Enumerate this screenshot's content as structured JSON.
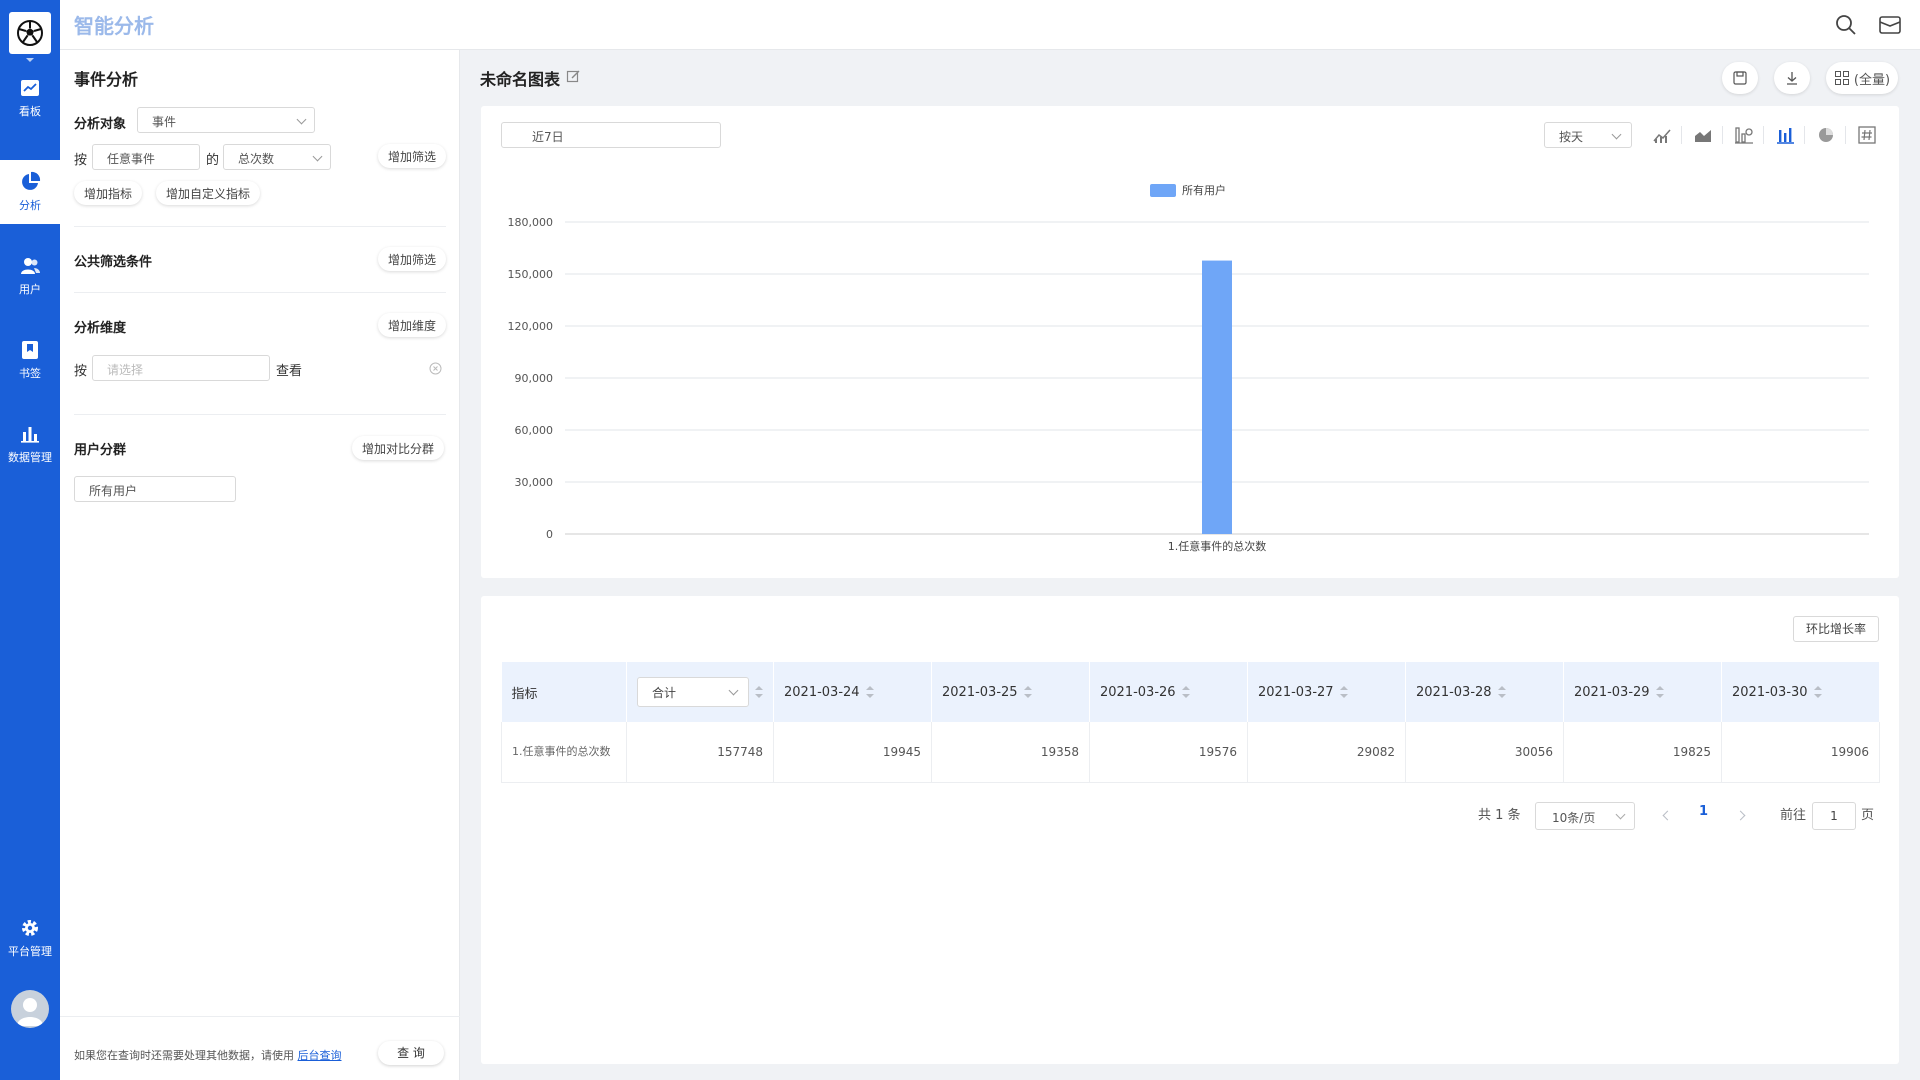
{
  "app": {
    "title": "智能分析"
  },
  "nav": {
    "items": [
      {
        "label": "看板",
        "icon": "chart-board-icon"
      },
      {
        "label": "分析",
        "icon": "pie-chart-icon"
      },
      {
        "label": "用户",
        "icon": "users-icon"
      },
      {
        "label": "书签",
        "icon": "bookmark-icon"
      },
      {
        "label": "数据管理",
        "icon": "bar-chart-icon"
      },
      {
        "label": "平台管理",
        "icon": "gear-icon"
      }
    ],
    "active": "分析"
  },
  "panel": {
    "title": "事件分析",
    "target_label": "分析对象",
    "target_value": "事件",
    "by_label": "按",
    "event_value": "任意事件",
    "of_label": "的",
    "metric_value": "总次数",
    "add_filter": "增加筛选",
    "add_metric": "增加指标",
    "add_custom_metric": "增加自定义指标",
    "common_filter_title": "公共筛选条件",
    "common_add_filter": "增加筛选",
    "dimension_title": "分析维度",
    "add_dimension": "增加维度",
    "dim_by_label": "按",
    "dim_placeholder": "请选择",
    "dim_view_label": "查看",
    "segment_title": "用户分群",
    "add_compare_segment": "增加对比分群",
    "segment_value": "所有用户",
    "footer_note": "如果您在查询时还需要处理其他数据，请使用",
    "footer_link": "后台查询",
    "query_button": "查 询"
  },
  "main": {
    "chart_title": "未命名图表",
    "fullscreen_label": "(全量)",
    "date_range": "近7日",
    "time_unit": "按天",
    "legend": "所有用户",
    "ratio_button": "环比增长率",
    "colors": {
      "bar": "#6fa6f7",
      "nav": "#1a5fd8",
      "header": "#ebf2fd"
    }
  },
  "chart_data": {
    "type": "bar",
    "categories": [
      "1.任意事件的总次数"
    ],
    "series": [
      {
        "name": "所有用户",
        "values": [
          157748
        ]
      }
    ],
    "yticks": [
      "180,000",
      "150,000",
      "120,000",
      "90,000",
      "60,000",
      "30,000",
      "0"
    ],
    "ylim": [
      0,
      180000
    ],
    "legend_position": "top-center",
    "grid": true
  },
  "table": {
    "first_header": "指标",
    "sum_select": "合计",
    "dates": [
      "2021-03-24",
      "2021-03-25",
      "2021-03-26",
      "2021-03-27",
      "2021-03-28",
      "2021-03-29",
      "2021-03-30"
    ],
    "row_label": "1.任意事件的总次数",
    "total": "157748",
    "values": [
      "19945",
      "19358",
      "19576",
      "29082",
      "30056",
      "19825",
      "19906"
    ]
  },
  "pagination": {
    "total_text": "共 1 条",
    "page_size": "10条/页",
    "current_page": "1",
    "goto_label": "前往",
    "goto_value": "1",
    "page_suffix": "页"
  }
}
